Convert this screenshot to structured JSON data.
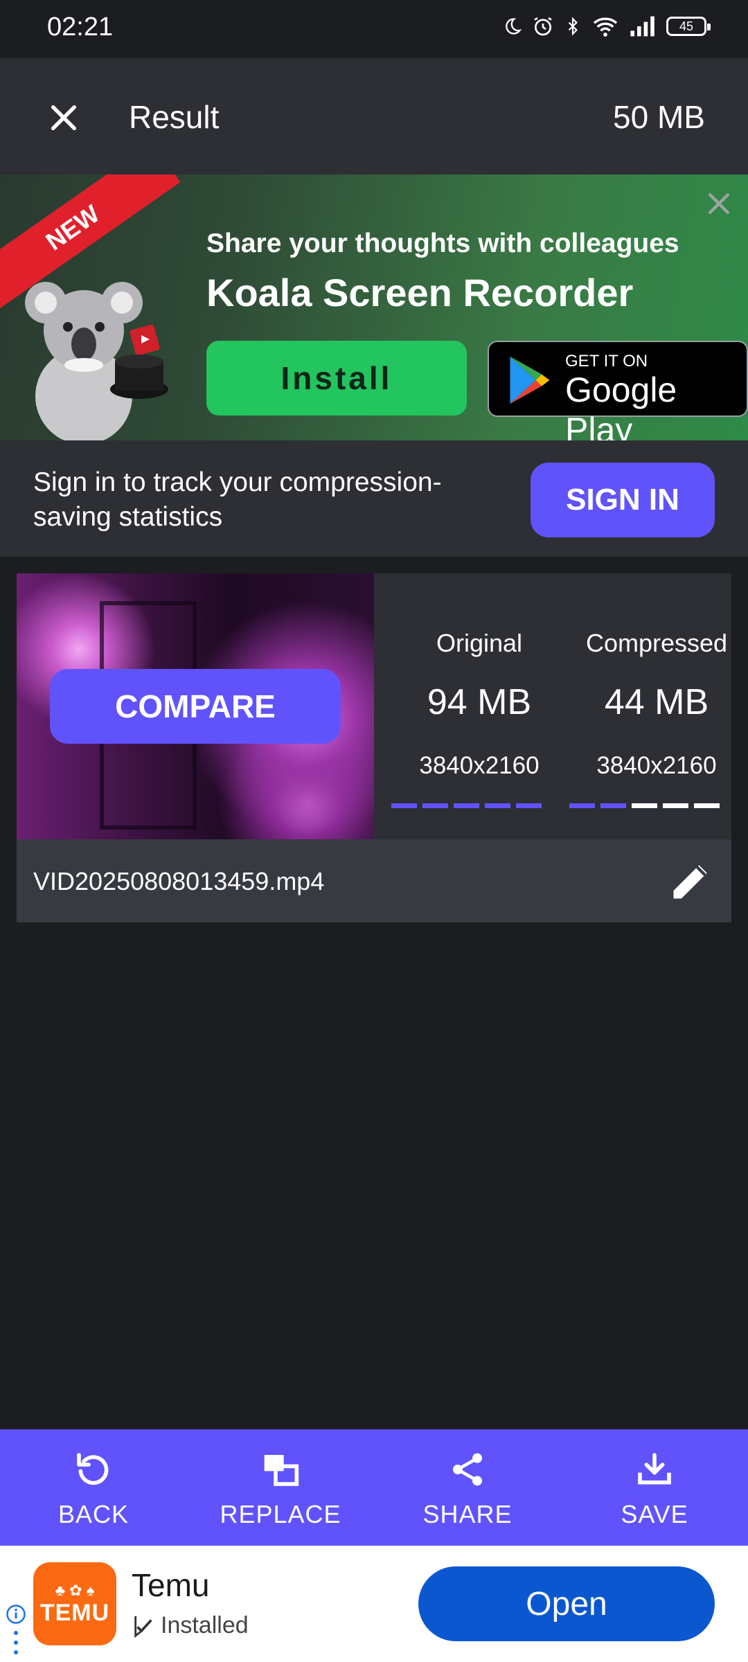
{
  "status_bar": {
    "time": "02:21",
    "battery": "45",
    "icons": [
      "moon-icon",
      "alarm-icon",
      "bluetooth-icon",
      "wifi-icon",
      "signal-icon",
      "battery-icon"
    ]
  },
  "app_bar": {
    "title": "Result",
    "size": "50 MB",
    "close_icon": "close-icon"
  },
  "ad_banner": {
    "ribbon": "NEW",
    "tagline": "Share your thoughts with colleagues",
    "app_name": "Koala Screen Recorder",
    "install_label": "Install",
    "store_small": "GET IT ON",
    "store_big": "Google Play"
  },
  "signin": {
    "text": "Sign in to track your compression-saving statistics",
    "button": "SIGN IN"
  },
  "result_card": {
    "compare_label": "COMPARE",
    "original": {
      "label": "Original",
      "size": "94 MB",
      "resolution": "3840x2160",
      "bar_filled": 5,
      "bar_total": 5
    },
    "compressed": {
      "label": "Compressed",
      "size": "44 MB",
      "resolution": "3840x2160",
      "bar_filled": 2,
      "bar_total": 5
    },
    "filename": "VID20250808013459.mp4"
  },
  "toolbar": {
    "items": [
      {
        "label": "BACK",
        "icon": "undo-icon"
      },
      {
        "label": "REPLACE",
        "icon": "replace-icon"
      },
      {
        "label": "SHARE",
        "icon": "share-icon"
      },
      {
        "label": "SAVE",
        "icon": "download-icon"
      }
    ]
  },
  "bottom_ad": {
    "app_name": "Temu",
    "logo_text": "TEMU",
    "status": "Installed",
    "button": "Open"
  },
  "colors": {
    "accent": "#6153fb",
    "background": "#1c1d21",
    "surface": "#2d2f35",
    "install_green": "#22c55e",
    "open_blue": "#0b57d0",
    "temu_orange": "#fb6a12"
  }
}
